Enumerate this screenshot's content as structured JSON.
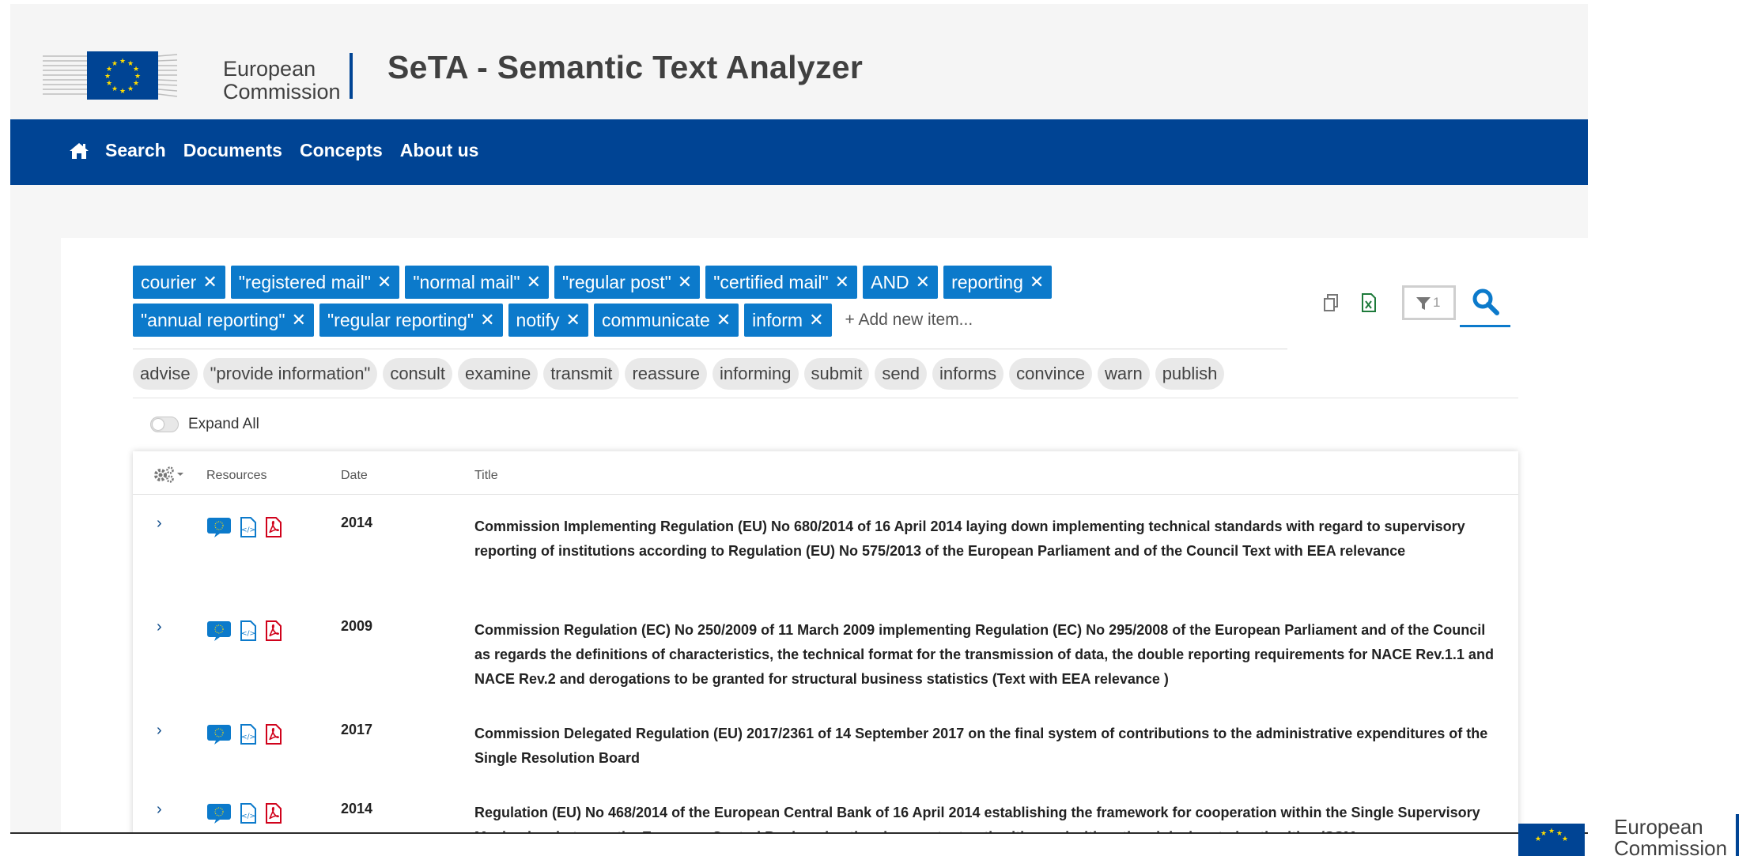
{
  "header": {
    "logo_line1": "European",
    "logo_line2": "Commission",
    "app_title": "SeTA - Semantic Text Analyzer"
  },
  "nav": {
    "items": [
      {
        "label": "Search"
      },
      {
        "label": "Documents"
      },
      {
        "label": "Concepts"
      },
      {
        "label": "About us"
      }
    ]
  },
  "search": {
    "chips_row1": [
      "courier",
      "\"registered mail\"",
      "\"normal mail\"",
      "\"regular post\"",
      "\"certified mail\"",
      "AND",
      "reporting"
    ],
    "chips_row2": [
      "\"annual reporting\"",
      "\"regular reporting\"",
      "notify",
      "communicate",
      "inform"
    ],
    "add_item": "+ Add new item...",
    "filter_count": "1",
    "suggestions": [
      "advise",
      "\"provide information\"",
      "consult",
      "examine",
      "transmit",
      "reassure",
      "informing",
      "submit",
      "send",
      "informs",
      "convince",
      "warn",
      "publish"
    ]
  },
  "expand_all": "Expand All",
  "table": {
    "headers": {
      "resources": "Resources",
      "date": "Date",
      "title": "Title"
    },
    "rows": [
      {
        "date": "2014",
        "title": "Commission Implementing Regulation (EU) No 680/2014 of 16 April 2014 laying down implementing technical standards with regard to supervisory reporting of institutions according to Regulation (EU) No 575/2013 of the European Parliament and of the Council Text with EEA relevance"
      },
      {
        "date": "2009",
        "title": "Commission Regulation (EC) No 250/2009 of 11 March 2009 implementing Regulation (EC) No 295/2008 of the European Parliament and of the Council as regards the definitions of characteristics, the technical format for the transmission of data, the double reporting requirements for NACE Rev.1.1 and NACE Rev.2 and derogations to be granted for structural business statistics (Text with EEA relevance )"
      },
      {
        "date": "2017",
        "title": "Commission Delegated Regulation (EU) 2017/2361 of 14 September 2017 on the final system of contributions to the administrative expenditures of the Single Resolution Board"
      },
      {
        "date": "2014",
        "title": "Regulation (EU) No 468/2014 of the European Central Bank of 16 April 2014 establishing the framework for cooperation within the Single Supervisory Mechanism between the European Central Bank and national competent authorities and with national designated authorities (SSM"
      }
    ]
  },
  "footer": {
    "logo_line1": "European",
    "logo_line2": "Commission"
  },
  "colors": {
    "brand_blue": "#004494",
    "chip_blue": "#0c7acb",
    "pdf_red": "#d0021b"
  }
}
